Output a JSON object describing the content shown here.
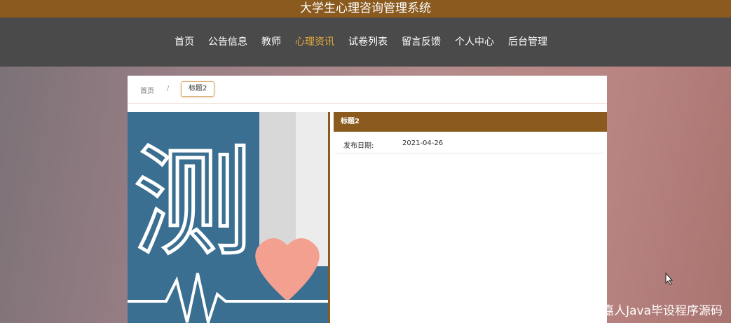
{
  "header": {
    "title": "大学生心理咨询管理系统"
  },
  "nav": {
    "items": [
      {
        "label": "首页",
        "active": false
      },
      {
        "label": "公告信息",
        "active": false
      },
      {
        "label": "教师",
        "active": false
      },
      {
        "label": "心理资讯",
        "active": true
      },
      {
        "label": "试卷列表",
        "active": false
      },
      {
        "label": "留言反馈",
        "active": false
      },
      {
        "label": "个人中心",
        "active": false
      },
      {
        "label": "后台管理",
        "active": false
      }
    ]
  },
  "breadcrumb": {
    "home": "首页",
    "separator": "/",
    "current": "标题2"
  },
  "article": {
    "title": "标题2",
    "date_label": "发布日期:",
    "date_value": "2021-04-26",
    "image": {
      "text": "测",
      "icon": "heart-icon"
    }
  },
  "watermark": "CSDN @嘉人Java毕设程序源码",
  "colors": {
    "brand_brown": "#8a5a1e",
    "nav_bg": "#4a4a4a",
    "nav_active": "#e2a93b",
    "image_blue": "#3b6f91",
    "heart": "#f4a090"
  }
}
